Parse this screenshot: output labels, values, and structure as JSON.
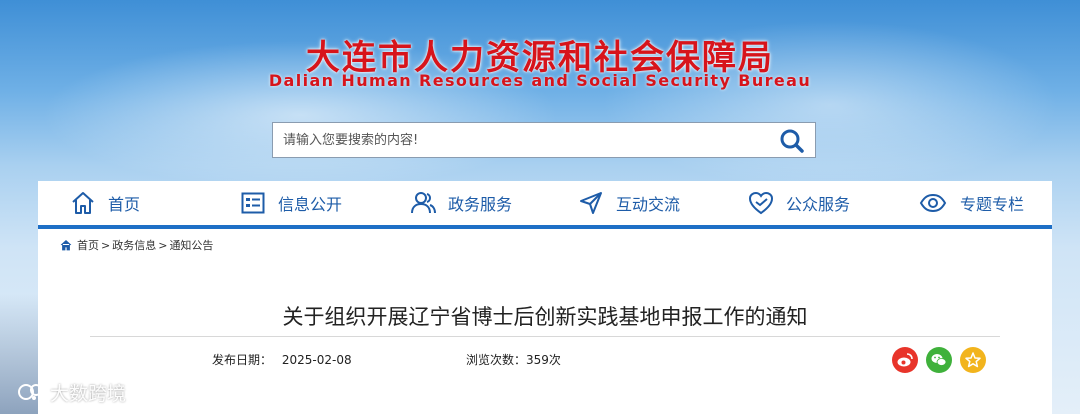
{
  "header": {
    "title_cn": "大连市人力资源和社会保障局",
    "title_en": "Dalian Human Resources and Social Security Bureau"
  },
  "search": {
    "placeholder": "请输入您要搜索的内容!",
    "icon": "search-icon"
  },
  "nav": {
    "items": [
      {
        "label": "首页",
        "icon": "home-icon"
      },
      {
        "label": "信息公开",
        "icon": "info-list-icon"
      },
      {
        "label": "政务服务",
        "icon": "people-icon"
      },
      {
        "label": "互动交流",
        "icon": "send-arrow-icon"
      },
      {
        "label": "公众服务",
        "icon": "heart-icon"
      },
      {
        "label": "专题专栏",
        "icon": "eye-icon"
      }
    ]
  },
  "breadcrumb": {
    "items": [
      "首页",
      "政务信息",
      "通知公告"
    ],
    "separator": ">"
  },
  "article": {
    "title": "关于组织开展辽宁省博士后创新实践基地申报工作的通知",
    "publish_label": "发布日期：",
    "publish_date": "2025-02-08",
    "views_label": "浏览次数：",
    "views": "359次"
  },
  "share": {
    "items": [
      {
        "icon": "weibo-icon",
        "color": "#e8342a"
      },
      {
        "icon": "wechat-icon",
        "color": "#3fb13b"
      },
      {
        "icon": "favorite-star-icon",
        "color": "#f2b41d"
      }
    ]
  },
  "watermark": {
    "text": "大数跨境"
  },
  "colors": {
    "brand_red": "#d7141b",
    "nav_blue": "#1e5ca8",
    "nav_bar": "#1e6fc6"
  }
}
